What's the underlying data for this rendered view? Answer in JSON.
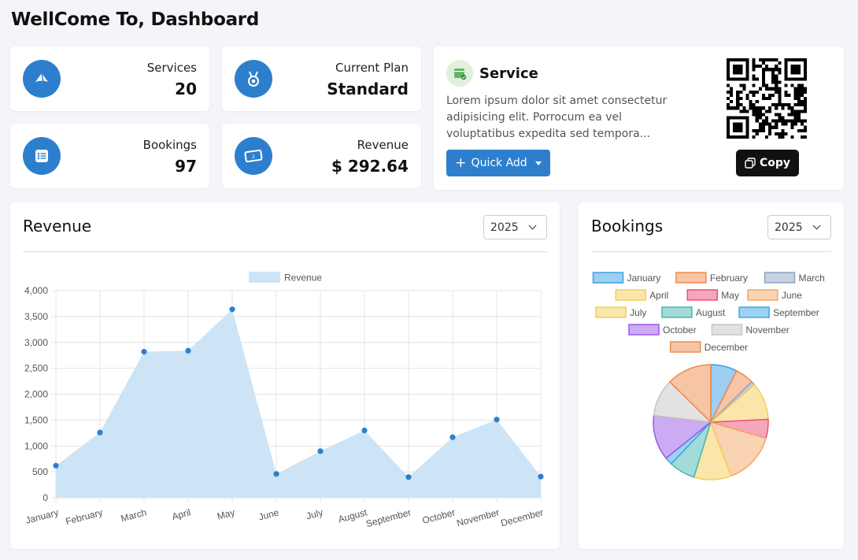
{
  "page": {
    "title": "WellCome To, Dashboard"
  },
  "stats": [
    {
      "label": "Services",
      "value": "20",
      "icon": "megaphone-icon"
    },
    {
      "label": "Current Plan",
      "value": "Standard",
      "icon": "medal-icon"
    },
    {
      "label": "Bookings",
      "value": "97",
      "icon": "list-icon"
    },
    {
      "label": "Revenue",
      "value": "$ 292.64",
      "icon": "banknote-icon"
    }
  ],
  "service": {
    "title": "Service",
    "description": "Lorem ipsum dolor sit amet consectetur adipisicing elit. Porrocum ea vel voluptatibus expedita sed tempora...",
    "quick_add_label": "Quick Add",
    "copy_label": "Copy",
    "icon": "calendar-check-icon"
  },
  "revenue_panel": {
    "title": "Revenue",
    "year": "2025"
  },
  "bookings_panel": {
    "title": "Bookings",
    "year": "2025"
  },
  "colors": {
    "accent": "#2d7fce",
    "area_fill": "#cce4f5",
    "dark": "#111111"
  },
  "chart_data": [
    {
      "type": "area",
      "legend": [
        "Revenue"
      ],
      "categories": [
        "January",
        "February",
        "March",
        "April",
        "May",
        "June",
        "July",
        "August",
        "September",
        "October",
        "November",
        "December"
      ],
      "series": [
        {
          "name": "Revenue",
          "values": [
            620,
            1260,
            2820,
            2840,
            3640,
            460,
            900,
            1300,
            400,
            1170,
            1510,
            410
          ]
        }
      ],
      "ylim": [
        0,
        4000
      ],
      "yticks": [
        "0",
        "500",
        "1,000",
        "1,500",
        "2,000",
        "2,500",
        "3,000",
        "3,500",
        "4,000"
      ],
      "grid": true,
      "legend_position": "top"
    },
    {
      "type": "pie",
      "categories": [
        "January",
        "February",
        "March",
        "April",
        "May",
        "June",
        "July",
        "August",
        "September",
        "October",
        "November",
        "December"
      ],
      "values": [
        7,
        5,
        1,
        10,
        5,
        14,
        10,
        7,
        2,
        12,
        10,
        12
      ],
      "colors": [
        "#3aa0e6",
        "#f08a4b",
        "#8ea3c4",
        "#f5cd55",
        "#ee4e78",
        "#f3a766",
        "#f5cd55",
        "#46b8b0",
        "#3aa8e8",
        "#9b58e8",
        "#c6c6c6",
        "#f08a4b"
      ],
      "legend_position": "top"
    }
  ]
}
